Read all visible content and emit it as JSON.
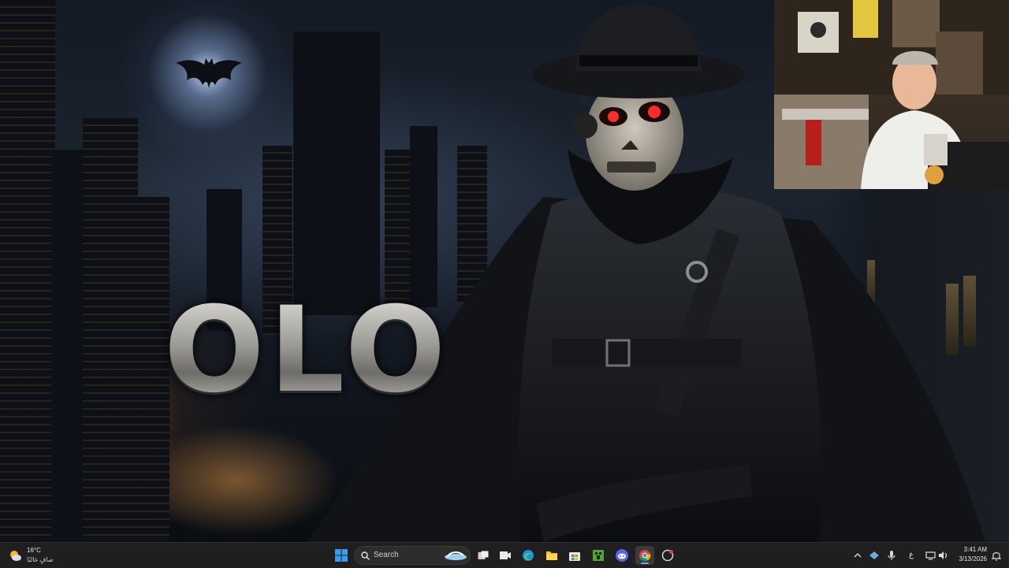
{
  "wallpaper": {
    "logo_text": "OLO"
  },
  "taskbar": {
    "weather": {
      "temp": "16°C",
      "condition": "صافٍ غالبًا",
      "icon": "partly-cloudy-icon"
    },
    "search": {
      "label": "Search",
      "icon": "search-icon"
    },
    "apps": [
      {
        "name": "start",
        "icon": "windows-logo-icon"
      },
      {
        "name": "search",
        "icon": "search-icon"
      },
      {
        "name": "task-view",
        "icon": "task-view-icon"
      },
      {
        "name": "streamer-app",
        "icon": "camera-app-icon"
      },
      {
        "name": "edge",
        "icon": "edge-browser-icon"
      },
      {
        "name": "file-explorer",
        "icon": "folder-icon"
      },
      {
        "name": "store",
        "icon": "store-bag-icon"
      },
      {
        "name": "minecraft",
        "icon": "minecraft-icon"
      },
      {
        "name": "discord",
        "icon": "discord-icon"
      },
      {
        "name": "chrome",
        "icon": "chrome-icon"
      },
      {
        "name": "recorder",
        "icon": "record-icon"
      }
    ],
    "tray": {
      "language": "ع",
      "icons": [
        "chevron-up-icon",
        "app-tray-icon",
        "microphone-icon",
        "network-icon",
        "volume-icon",
        "notification-icon"
      ]
    },
    "clock": {
      "time": "3:41 AM",
      "date": "3/13/2026"
    },
    "colors": {
      "accent": "#6aa7ff",
      "background": "#1f1f1f"
    }
  }
}
